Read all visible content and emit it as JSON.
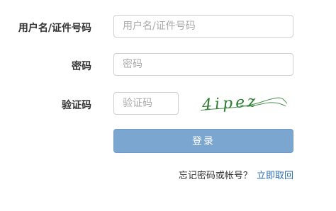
{
  "form": {
    "username": {
      "label": "用户名/证件号码",
      "placeholder": "用户名/证件号码",
      "value": ""
    },
    "password": {
      "label": "密码",
      "placeholder": "密码",
      "value": ""
    },
    "captcha": {
      "label": "验证码",
      "placeholder": "验证码",
      "value": "",
      "image_text": "4ipez",
      "image_color": "#2e7d32"
    },
    "submit_label": "登录",
    "forgot_text": "忘记密码或帐号？",
    "retrieve_link": "立即取回"
  },
  "colors": {
    "button_bg": "#7ba6cf",
    "link": "#2b6cb0",
    "border": "#cfcfcf"
  }
}
